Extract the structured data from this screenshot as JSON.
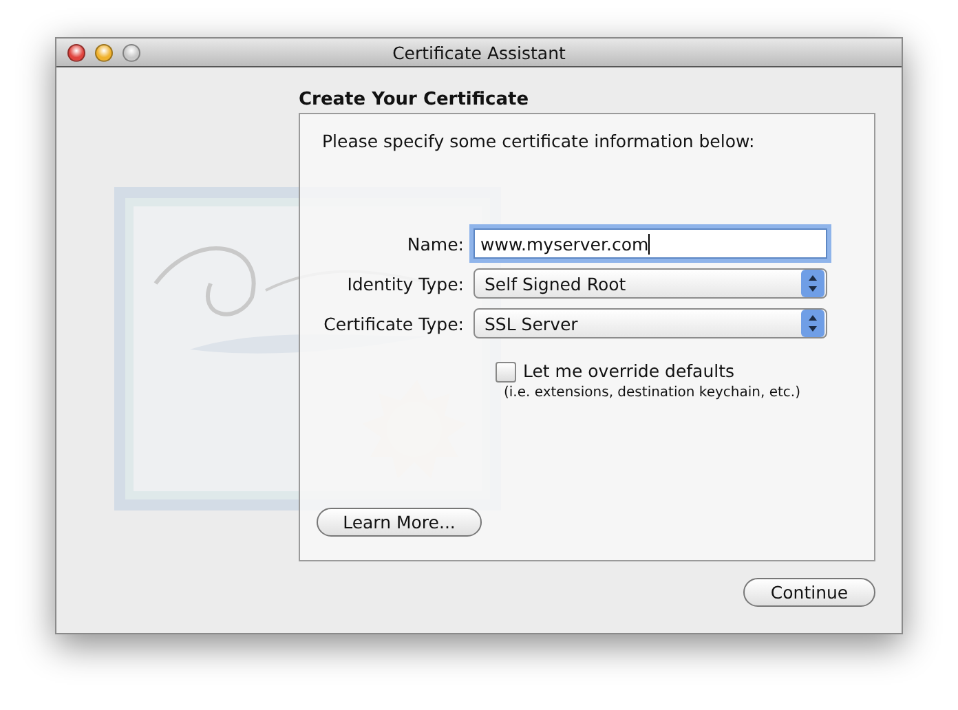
{
  "window": {
    "title": "Certificate Assistant",
    "controls": [
      {
        "kind": "close",
        "disabled": false
      },
      {
        "kind": "minimize",
        "disabled": false
      },
      {
        "kind": "zoom",
        "disabled": true
      }
    ]
  },
  "heading": "Create Your Certificate",
  "intro": "Please specify some certificate information below:",
  "fields": [
    {
      "kind": "text",
      "label": "Name:",
      "value": "www.myserver.com",
      "focused": true
    },
    {
      "kind": "popup",
      "label": "Identity Type:",
      "value": "Self Signed Root"
    },
    {
      "kind": "popup",
      "label": "Certificate Type:",
      "value": "SSL Server"
    }
  ],
  "override": {
    "label": "Let me override defaults",
    "hint": "(i.e. extensions, destination keychain, etc.)",
    "checked": false
  },
  "learn_more": "Learn More...",
  "continue": "Continue"
}
